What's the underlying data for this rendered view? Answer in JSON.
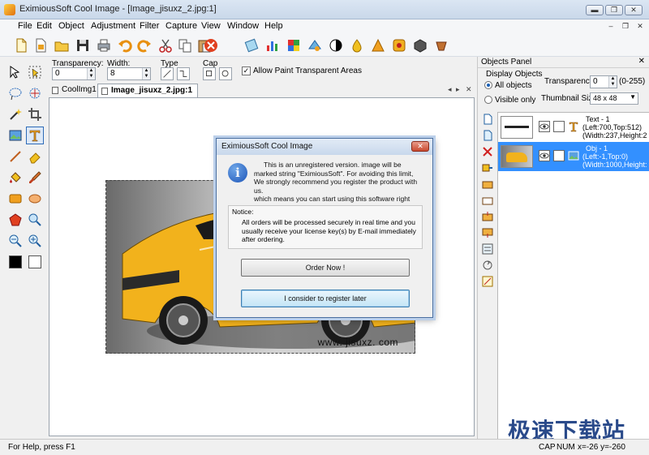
{
  "window": {
    "title": "EximiousSoft Cool Image - [Image_jisuxz_2.jpg:1]",
    "controls": {
      "minimize": "▬",
      "restore": "❐",
      "close": "✕"
    }
  },
  "menubar": {
    "items": [
      "File",
      "Edit",
      "Object",
      "Adjustment",
      "Filter",
      "Capture",
      "View",
      "Window",
      "Help"
    ],
    "mdi_controls": [
      "–",
      "❐",
      "✕"
    ]
  },
  "properties": {
    "transparency_label": "Transparency:",
    "transparency_value": "0",
    "width_label": "Width:",
    "width_value": "8",
    "type_label": "Type",
    "cap_label": "Cap",
    "allow_paint_label": "Allow Paint Transparent Areas",
    "allow_paint_checked": "✓"
  },
  "tabs": [
    {
      "label": "CoolImg1"
    },
    {
      "label": "Image_jisuxz_2.jpg:1"
    }
  ],
  "tab_nav": {
    "left": "◂",
    "right": "▸",
    "close": "✕"
  },
  "canvas": {
    "watermark": "www. jisuxz. com"
  },
  "dialog": {
    "title": "EximiousSoft Cool Image",
    "close": "✕",
    "icon_glyph": "i",
    "message_1": "This is an unregistered version. image will be marked string \"EximiousSoft\". For avoiding this limit, We strongly recommend you register the product with us.",
    "message_2": "which means you can start using this software right after ordering a license -no trouble, no limit.",
    "notice_title": "Notice:",
    "notice_body": "All orders will be processed securely in real time and you usually receive your license key(s) by E-mail immediately after ordering.",
    "order_button": "Order Now !",
    "later_button": "I consider to register later"
  },
  "objects_panel": {
    "title": "Objects Panel",
    "close": "✕",
    "display_objects_label": "Display Objects",
    "all_objects_label": "All objects",
    "visible_only_label": "Visible only",
    "transparency_label": "Transparency:",
    "transparency_value": "0",
    "transparency_range": "(0-255)",
    "thumbnail_size_label": "Thumbnail Size:",
    "thumbnail_size_value": "48 x 48",
    "objects": [
      {
        "line1": "Text - 1",
        "line2": "(Left:700,Top:512)",
        "line3": "(Width:237,Height:2"
      },
      {
        "line1": "Obj - 1",
        "line2": "(Left:-1,Top:0)",
        "line3": "(Width:1000,Height:"
      }
    ]
  },
  "statusbar": {
    "help": "For Help, press F1",
    "cap": "CAP",
    "num": "NUM",
    "coords": "x=-26  y=-260"
  },
  "corner_watermark": "极速下载站",
  "colors": {
    "accent": "#3390ff",
    "title_bar": "#c9d8ea",
    "car_yellow": "#f2b21c"
  }
}
